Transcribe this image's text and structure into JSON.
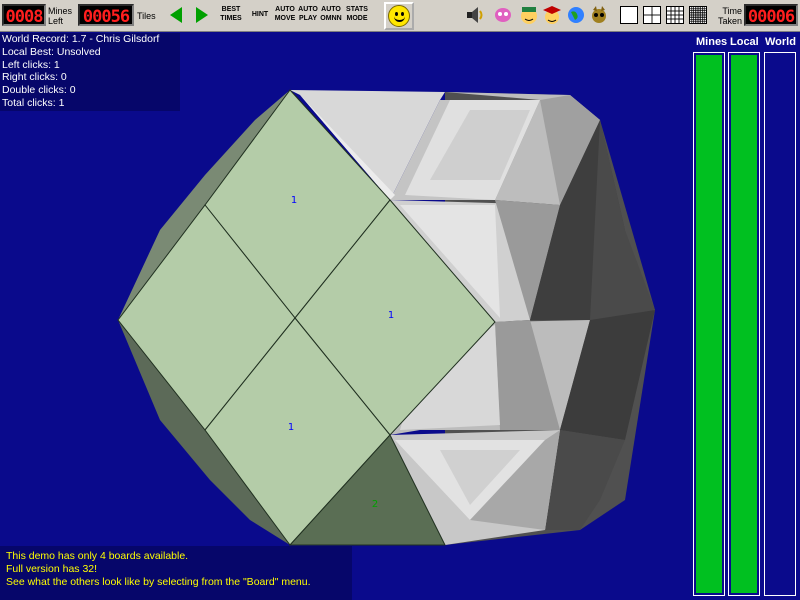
{
  "toolbar": {
    "mines_counter": "0008",
    "mines_label": "Mines\nLeft",
    "tiles_counter": "00056",
    "tiles_label": "Tiles",
    "buttons": [
      {
        "name": "best-times-button",
        "label": "BEST\nTIMES"
      },
      {
        "name": "hint-button",
        "label": "HINT"
      },
      {
        "name": "auto-move-button",
        "label": "AUTO\nMOVE"
      },
      {
        "name": "auto-play-button",
        "label": "AUTO\nPLAY"
      },
      {
        "name": "auto-omnn-button",
        "label": "AUTO\nOMNN"
      },
      {
        "name": "stats-mode-button",
        "label": "STATS\nMODE"
      }
    ],
    "time_label": "Time\nTaken",
    "time_counter": "00006",
    "icons": [
      "speaker-icon",
      "brain-icon",
      "face-icon",
      "graduate-icon",
      "globe-icon",
      "creature-icon"
    ],
    "view_buttons": [
      "single-view-icon",
      "quad-view-icon",
      "grid-view-icon",
      "dense-grid-view-icon"
    ]
  },
  "info": {
    "world_record": "World Record: 1.7 - Chris Gilsdorf",
    "local_best": "Local Best: Unsolved",
    "left_clicks": "Left clicks: 1",
    "right_clicks": "Right clicks: 0",
    "double_clicks": "Double clicks: 0",
    "total_clicks": "Total clicks: 1"
  },
  "message": {
    "line1": "This demo has only 4 boards available.",
    "line2": "Full version has 32!",
    "line3": "See what the others look like by selecting from the \"Board\" menu."
  },
  "bars": {
    "mines_label": "Mines",
    "local_label": "Local",
    "world_label": "World",
    "mines_fill": 1.0,
    "local_fill": 1.0,
    "world_fill": 0.0
  },
  "board": {
    "numbers": [
      {
        "value": "1",
        "color": "#0000ff"
      },
      {
        "value": "1",
        "color": "#0000ff"
      },
      {
        "value": "1",
        "color": "#0000ff"
      },
      {
        "value": "2",
        "color": "#00a000"
      }
    ]
  },
  "colors": {
    "background": "#0a0a8c",
    "revealed": "#b4cca8",
    "led_text": "#ff1e1e",
    "bar_fill": "#00c020"
  }
}
